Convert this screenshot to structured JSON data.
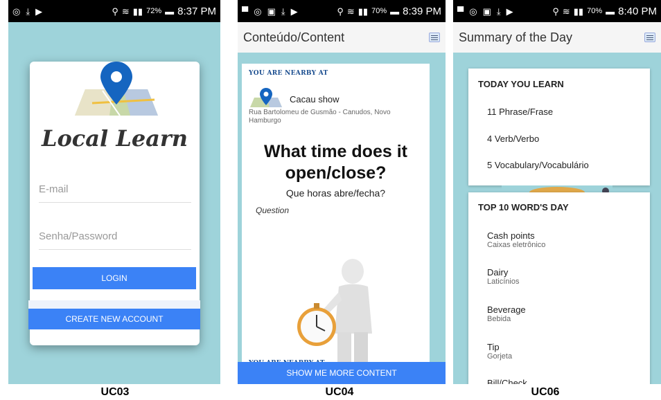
{
  "screens": [
    {
      "caption": "UC03",
      "status": {
        "time": "8:37 PM",
        "battery": "72%"
      },
      "login": {
        "title": "Local Learn",
        "email_placeholder": "E-mail",
        "password_placeholder": "Senha/Password",
        "login_label": "LOGIN",
        "create_label": "CREATE NEW ACCOUNT"
      }
    },
    {
      "caption": "UC04",
      "status": {
        "time": "8:39 PM",
        "battery": "70%"
      },
      "appbar_title": "Conteúdo/Content",
      "nearby_label": "YOU ARE NEARBY AT",
      "place_name": "Cacau show",
      "place_address": "Rua Bartolomeu de Gusmão - Canudos, Novo Hamburgo",
      "question_en": "What time does it open/close?",
      "question_pt": "Que horas abre/fecha?",
      "question_label": "Question",
      "nearby_label_2": "YOU ARE NEARBY AT",
      "show_more_label": "SHOW ME MORE CONTENT"
    },
    {
      "caption": "UC06",
      "status": {
        "time": "8:40 PM",
        "battery": "70%"
      },
      "appbar_title": "Summary of the Day",
      "today_title": "TODAY YOU LEARN",
      "today_items": [
        "11 Phrase/Frase",
        "4 Verb/Verbo",
        "5 Vocabulary/Vocabulário"
      ],
      "top_title": "TOP 10 WORD'S DAY",
      "words": [
        {
          "en": "Cash points",
          "pt": "Caixas eletrônico"
        },
        {
          "en": "Dairy",
          "pt": "Laticínios"
        },
        {
          "en": "Beverage",
          "pt": "Bebida"
        },
        {
          "en": "Tip",
          "pt": "Gorjeta"
        },
        {
          "en": "Bill/Check",
          "pt": ""
        }
      ]
    }
  ],
  "colors": {
    "accent": "#3b82f6",
    "background": "#9ed3da",
    "nearby_text": "#1a4d8f"
  }
}
